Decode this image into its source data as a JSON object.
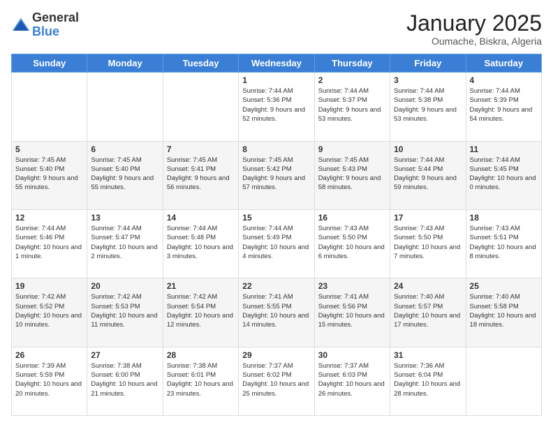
{
  "logo": {
    "general": "General",
    "blue": "Blue"
  },
  "title": "January 2025",
  "location": "Oumache, Biskra, Algeria",
  "days_of_week": [
    "Sunday",
    "Monday",
    "Tuesday",
    "Wednesday",
    "Thursday",
    "Friday",
    "Saturday"
  ],
  "weeks": [
    [
      {
        "day": "",
        "info": ""
      },
      {
        "day": "",
        "info": ""
      },
      {
        "day": "",
        "info": ""
      },
      {
        "day": "1",
        "info": "Sunrise: 7:44 AM\nSunset: 5:36 PM\nDaylight: 9 hours and 52 minutes."
      },
      {
        "day": "2",
        "info": "Sunrise: 7:44 AM\nSunset: 5:37 PM\nDaylight: 9 hours and 53 minutes."
      },
      {
        "day": "3",
        "info": "Sunrise: 7:44 AM\nSunset: 5:38 PM\nDaylight: 9 hours and 53 minutes."
      },
      {
        "day": "4",
        "info": "Sunrise: 7:44 AM\nSunset: 5:39 PM\nDaylight: 9 hours and 54 minutes."
      }
    ],
    [
      {
        "day": "5",
        "info": "Sunrise: 7:45 AM\nSunset: 5:40 PM\nDaylight: 9 hours and 55 minutes."
      },
      {
        "day": "6",
        "info": "Sunrise: 7:45 AM\nSunset: 5:40 PM\nDaylight: 9 hours and 55 minutes."
      },
      {
        "day": "7",
        "info": "Sunrise: 7:45 AM\nSunset: 5:41 PM\nDaylight: 9 hours and 56 minutes."
      },
      {
        "day": "8",
        "info": "Sunrise: 7:45 AM\nSunset: 5:42 PM\nDaylight: 9 hours and 57 minutes."
      },
      {
        "day": "9",
        "info": "Sunrise: 7:45 AM\nSunset: 5:43 PM\nDaylight: 9 hours and 58 minutes."
      },
      {
        "day": "10",
        "info": "Sunrise: 7:44 AM\nSunset: 5:44 PM\nDaylight: 9 hours and 59 minutes."
      },
      {
        "day": "11",
        "info": "Sunrise: 7:44 AM\nSunset: 5:45 PM\nDaylight: 10 hours and 0 minutes."
      }
    ],
    [
      {
        "day": "12",
        "info": "Sunrise: 7:44 AM\nSunset: 5:46 PM\nDaylight: 10 hours and 1 minute."
      },
      {
        "day": "13",
        "info": "Sunrise: 7:44 AM\nSunset: 5:47 PM\nDaylight: 10 hours and 2 minutes."
      },
      {
        "day": "14",
        "info": "Sunrise: 7:44 AM\nSunset: 5:48 PM\nDaylight: 10 hours and 3 minutes."
      },
      {
        "day": "15",
        "info": "Sunrise: 7:44 AM\nSunset: 5:49 PM\nDaylight: 10 hours and 4 minutes."
      },
      {
        "day": "16",
        "info": "Sunrise: 7:43 AM\nSunset: 5:50 PM\nDaylight: 10 hours and 6 minutes."
      },
      {
        "day": "17",
        "info": "Sunrise: 7:43 AM\nSunset: 5:50 PM\nDaylight: 10 hours and 7 minutes."
      },
      {
        "day": "18",
        "info": "Sunrise: 7:43 AM\nSunset: 5:51 PM\nDaylight: 10 hours and 8 minutes."
      }
    ],
    [
      {
        "day": "19",
        "info": "Sunrise: 7:42 AM\nSunset: 5:52 PM\nDaylight: 10 hours and 10 minutes."
      },
      {
        "day": "20",
        "info": "Sunrise: 7:42 AM\nSunset: 5:53 PM\nDaylight: 10 hours and 11 minutes."
      },
      {
        "day": "21",
        "info": "Sunrise: 7:42 AM\nSunset: 5:54 PM\nDaylight: 10 hours and 12 minutes."
      },
      {
        "day": "22",
        "info": "Sunrise: 7:41 AM\nSunset: 5:55 PM\nDaylight: 10 hours and 14 minutes."
      },
      {
        "day": "23",
        "info": "Sunrise: 7:41 AM\nSunset: 5:56 PM\nDaylight: 10 hours and 15 minutes."
      },
      {
        "day": "24",
        "info": "Sunrise: 7:40 AM\nSunset: 5:57 PM\nDaylight: 10 hours and 17 minutes."
      },
      {
        "day": "25",
        "info": "Sunrise: 7:40 AM\nSunset: 5:58 PM\nDaylight: 10 hours and 18 minutes."
      }
    ],
    [
      {
        "day": "26",
        "info": "Sunrise: 7:39 AM\nSunset: 5:59 PM\nDaylight: 10 hours and 20 minutes."
      },
      {
        "day": "27",
        "info": "Sunrise: 7:38 AM\nSunset: 6:00 PM\nDaylight: 10 hours and 21 minutes."
      },
      {
        "day": "28",
        "info": "Sunrise: 7:38 AM\nSunset: 6:01 PM\nDaylight: 10 hours and 23 minutes."
      },
      {
        "day": "29",
        "info": "Sunrise: 7:37 AM\nSunset: 6:02 PM\nDaylight: 10 hours and 25 minutes."
      },
      {
        "day": "30",
        "info": "Sunrise: 7:37 AM\nSunset: 6:03 PM\nDaylight: 10 hours and 26 minutes."
      },
      {
        "day": "31",
        "info": "Sunrise: 7:36 AM\nSunset: 6:04 PM\nDaylight: 10 hours and 28 minutes."
      },
      {
        "day": "",
        "info": ""
      }
    ]
  ]
}
